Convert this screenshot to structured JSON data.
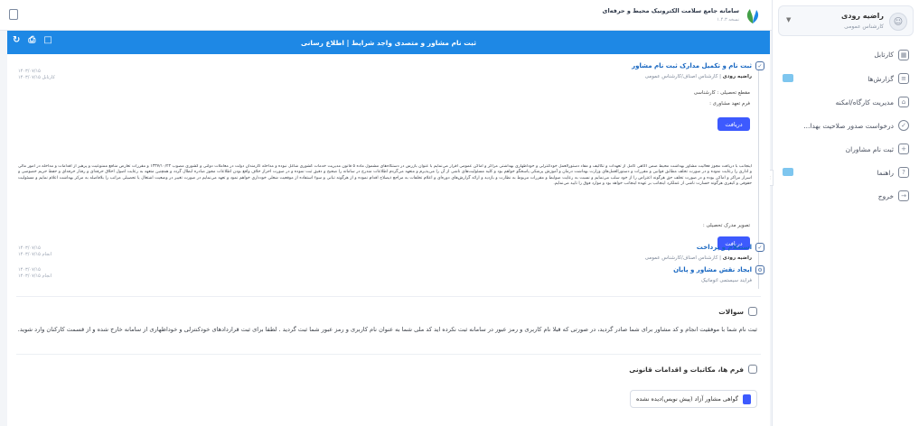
{
  "user": {
    "name": "راضیه رودی",
    "role": "کارشناس عمومی"
  },
  "sidebar": {
    "items": [
      {
        "label": "کارتابل",
        "icon": "grid-icon"
      },
      {
        "label": "گزارش‌ها",
        "icon": "report-icon",
        "badge": true
      },
      {
        "label": "مدیریت کارگاه/امکنه",
        "icon": "home-icon"
      },
      {
        "label": "درخواست صدور صلاحیت بهدا...",
        "icon": "check-circle-icon"
      },
      {
        "label": "ثبت نام مشاوران",
        "icon": "user-add-icon"
      },
      {
        "label": "راهنما",
        "icon": "help-icon",
        "badge": true
      },
      {
        "label": "خروج",
        "icon": "logout-icon"
      }
    ]
  },
  "header": {
    "title": "سامانه جامع سلامت الکترونیک محیط و حرفه‌ای",
    "subtitle": "نسخه ۱.۴.۳"
  },
  "panel": {
    "title": "ثبت نام مشاور و متصدی واجد شرایط | اطلاع رسانی"
  },
  "steps": [
    {
      "title": "ثبت نام و تکمیل مدارک ثبت نام مشاور",
      "user": "راضیه رودی",
      "meta": "| کارشناس اصناف/کارشناس عمومی",
      "date1": "۱۴۰۳/۰۷/۱۵",
      "date2": "کارتابل ۱۴۰۳/۰۷/۱۵",
      "field1": "مقطع تحصیلی : کارشناسی",
      "field2": "فرم تعهد مشاوری :",
      "button": "دریافت",
      "field3": "تصویر مدرک تحصیلی :",
      "button2": "دریافت"
    },
    {
      "title": "استعلام و پرداخت",
      "user": "راضیه رودی",
      "meta": "| کارشناس اصناف/کارشناس عمومی",
      "date1": "۱۴۰۳/۰۷/۱۵",
      "date2": "انجام ۱۴۰۳/۰۷/۱۵"
    },
    {
      "title": "ایجاد نقش مشاور و پایان",
      "meta": "فرایند سیستمی اتوماتیک",
      "date1": "۱۴۰۳/۰۷/۱۵",
      "date2": "انجام ۱۴۰۳/۰۷/۱۵"
    }
  ],
  "body_text": "اینجانب با دریافت مجوز فعالیت مشاور بهداشت محیط ضمن آگاهی کامل از تعهدات و تکالیف و مفاد دستورالعمل خودکنترلی و خوداظهاری بهداشتی مراکز و اماکن عمومی اقرار می‌نمایم با عنوان بازرس در دستگاه‌های مشمول ماده ۵ قانون مدیریت خدمات کشوری شاغل نبوده و مداخله کارمندان دولت در معاملات دولتی و کشوری مصوب ۱۳۳۷/۱۰/۲۲ و مقررات تعارض منافع ممنوعیت و پرهیز از اقدامات و مداخله در امور مالی و اداری را رعایت نموده و در صورت تخلف مطابق قوانین و مقررات و دستورالعمل‌های وزارت بهداشت درمان و آموزش پزشکی پاسخگو خواهم بود و کلیه مسئولیت‌های ناشی از آن را می‌پذیرم و متعهد می‌گردم اطلاعات مندرج در سامانه را صحیح و دقیق ثبت نموده و در صورت احراز خلاف واقع بودن اطلاعات مجوز صادره ابطال گردد و همچنین متعهد به رعایت اصول اخلاق حرفه‌ای و رفتار حرفه‌ای و حفظ حریم خصوصی و اسرار مراکز و اماکن بوده و در صورت تخلف حق هرگونه اعتراض را از خود سلب می‌نمایم و نسبت به رعایت ضوابط و مقررات مربوط به نظارت و بازدید و ارائه گزارش‌های دوره‌ای و اعلام تخلفات به مراجع ذیصلاح اقدام نموده و از هرگونه تبانی و سوء استفاده از موقعیت شغلی خودداری خواهم نمود و تعهد می‌نمایم در صورت تغییر در وضعیت اشتغال یا تحصیلی مراتب را بلافاصله به مرکز بهداشت اعلام نمایم و مسئولیت حقوقی و کیفری هرگونه خسارت ناشی از عملکرد اینجانب بر عهده اینجانب خواهد بود و موارد فوق را تایید می‌نمایم.",
  "faq": {
    "title": "سوالات",
    "text": "ثبت نام شما با موفقیت انجام و کد مشاور برای شما صادر گردید، در صورتی که قبلا نام کاربری و رمز عبور در سامانه ثبت نکرده اید کد ملی شما به عنوان نام کاربری و رمز عبور شما ثبت گردید . لطفا برای ثبت قراردادهای خودکنترلی و خوداظهاری از سامانه خارج شده و از قسمت کارکنان وارد شوید."
  },
  "forms": {
    "title": "فرم ها، مکاتبات و اقدامات قانونی",
    "doc_label": "گواهی مشاور آزاد (پیش نویس)دیده نشده"
  },
  "colors": {
    "accent": "#1e88e5",
    "button": "#3d5afe",
    "badge": "#7ec6ef"
  }
}
